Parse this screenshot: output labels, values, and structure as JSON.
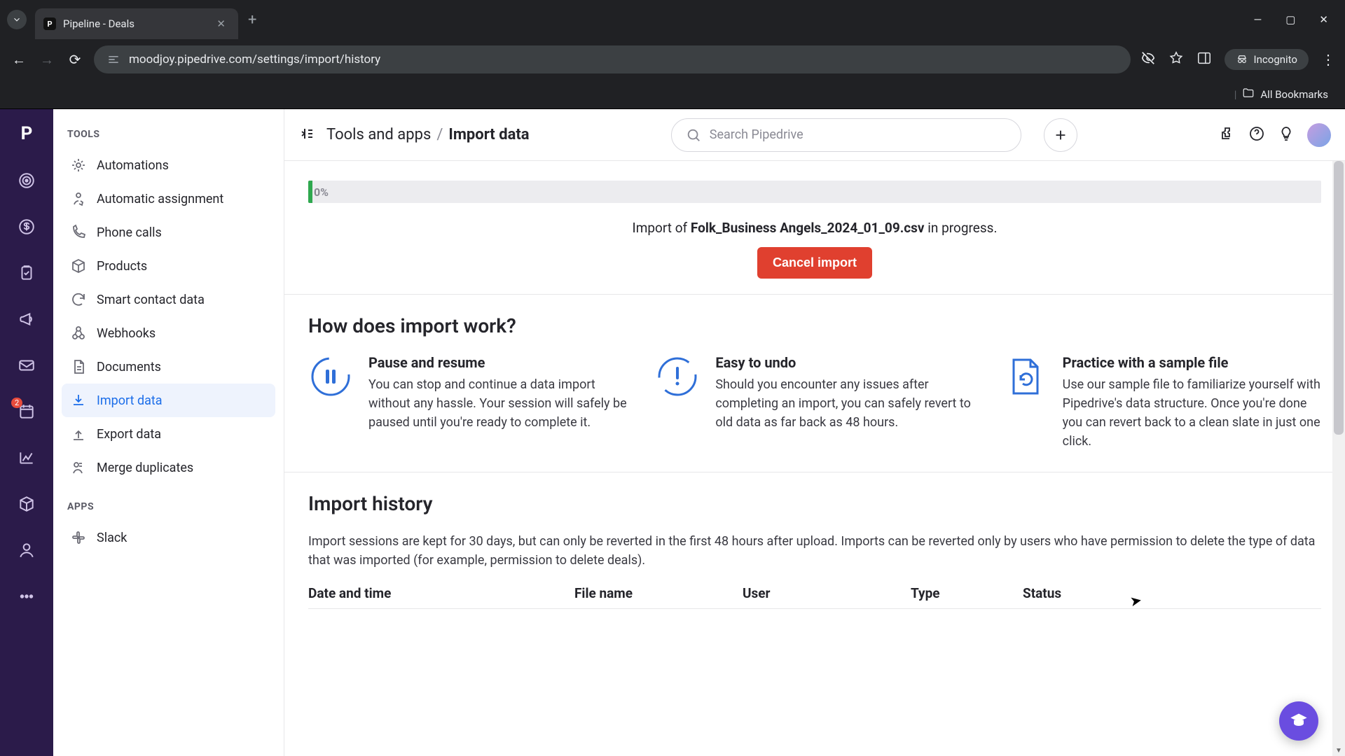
{
  "browser": {
    "tab_title": "Pipeline - Deals",
    "url": "moodjoy.pipedrive.com/settings/import/history",
    "incognito_label": "Incognito",
    "all_bookmarks": "All Bookmarks"
  },
  "rail": {
    "badge_count": "2"
  },
  "topbar": {
    "crumb_parent": "Tools and apps",
    "crumb_sep": "/",
    "crumb_current": "Import data",
    "search_placeholder": "Search Pipedrive"
  },
  "sidebar": {
    "section_tools": "TOOLS",
    "section_apps": "APPS",
    "items": [
      {
        "label": "Automations"
      },
      {
        "label": "Automatic assignment"
      },
      {
        "label": "Phone calls"
      },
      {
        "label": "Products"
      },
      {
        "label": "Smart contact data"
      },
      {
        "label": "Webhooks"
      },
      {
        "label": "Documents"
      },
      {
        "label": "Import data"
      },
      {
        "label": "Export data"
      },
      {
        "label": "Merge duplicates"
      }
    ],
    "apps": [
      {
        "label": "Slack"
      }
    ]
  },
  "import_status": {
    "percent_label": "0%",
    "prefix": "Import of ",
    "filename": "Folk_Business Angels_2024_01_09.csv",
    "suffix": " in progress.",
    "cancel_label": "Cancel import"
  },
  "how_it_works": {
    "heading": "How does import work?",
    "features": [
      {
        "title": "Pause and resume",
        "body": "You can stop and continue a data import without any hassle. Your session will safely be paused until you're ready to complete it."
      },
      {
        "title": "Easy to undo",
        "body": "Should you encounter any issues after completing an import, you can safely revert to old data as far back as 48 hours."
      },
      {
        "title": "Practice with a sample file",
        "body": "Use our sample file to familiarize yourself with Pipedrive's data structure. Once you're done you can revert back to a clean slate in just one click."
      }
    ]
  },
  "history": {
    "heading": "Import history",
    "subtext": "Import sessions are kept for 30 days, but can only be reverted in the first 48 hours after upload. Imports can be reverted only by users who have permission to delete the type of data that was imported (for example, permission to delete deals).",
    "columns": {
      "date": "Date and time",
      "file": "File name",
      "user": "User",
      "type": "Type",
      "status": "Status"
    }
  },
  "colors": {
    "accent": "#1c6ee9",
    "danger": "#e0402f",
    "rail": "#2b1b4a",
    "fab": "#6a4de0",
    "progress_fill": "#2fa84f"
  }
}
